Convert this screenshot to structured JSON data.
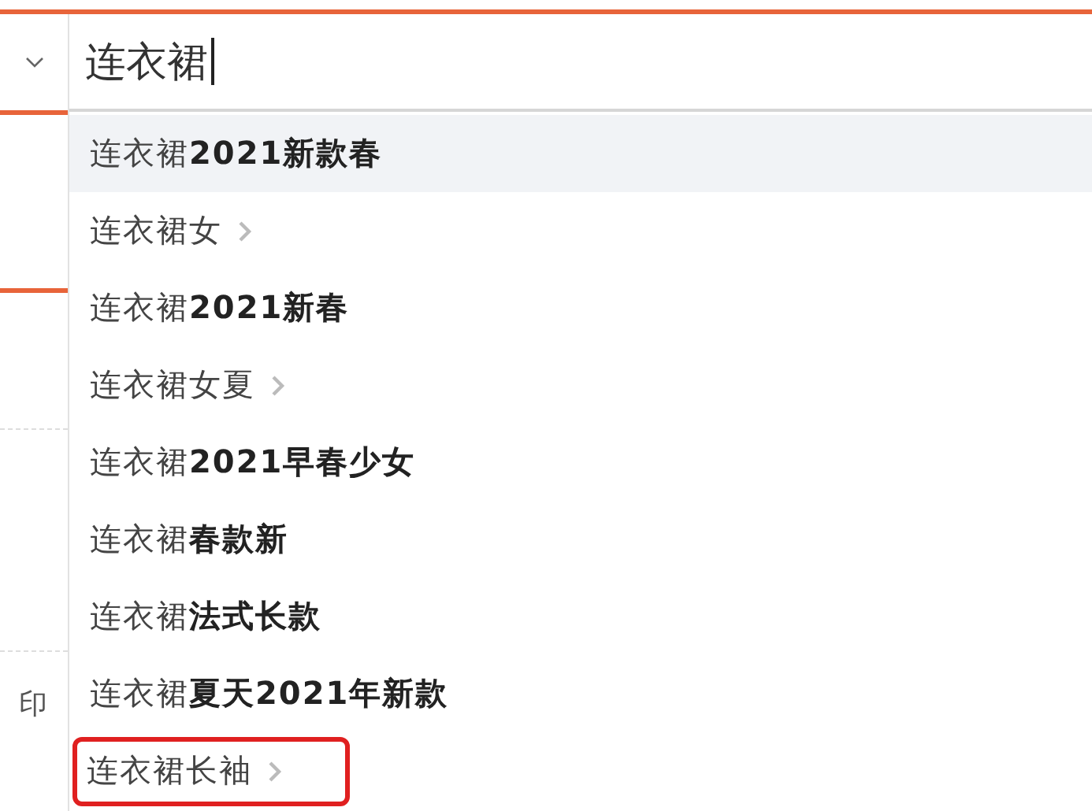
{
  "search": {
    "value": "连衣裙"
  },
  "left_panel": {
    "text": "印"
  },
  "suggestions": [
    {
      "text": "连衣裙**2021新款春**",
      "has_arrow": false,
      "selected": true,
      "outlined": false
    },
    {
      "text": "连衣裙女",
      "has_arrow": true,
      "selected": false,
      "outlined": false
    },
    {
      "text": "连衣裙**2021新春**",
      "has_arrow": false,
      "selected": false,
      "outlined": false
    },
    {
      "text": "连衣裙女夏",
      "has_arrow": true,
      "selected": false,
      "outlined": false
    },
    {
      "text": "连衣裙**2021早春少女**",
      "has_arrow": false,
      "selected": false,
      "outlined": false
    },
    {
      "text": "连衣裙**春款新**",
      "has_arrow": false,
      "selected": false,
      "outlined": false
    },
    {
      "text": "连衣裙**法式长款**",
      "has_arrow": false,
      "selected": false,
      "outlined": false
    },
    {
      "text": "连衣裙**夏天2021年新款**",
      "has_arrow": false,
      "selected": false,
      "outlined": false
    },
    {
      "text": "连衣裙长袖",
      "has_arrow": true,
      "selected": false,
      "outlined": true
    }
  ]
}
